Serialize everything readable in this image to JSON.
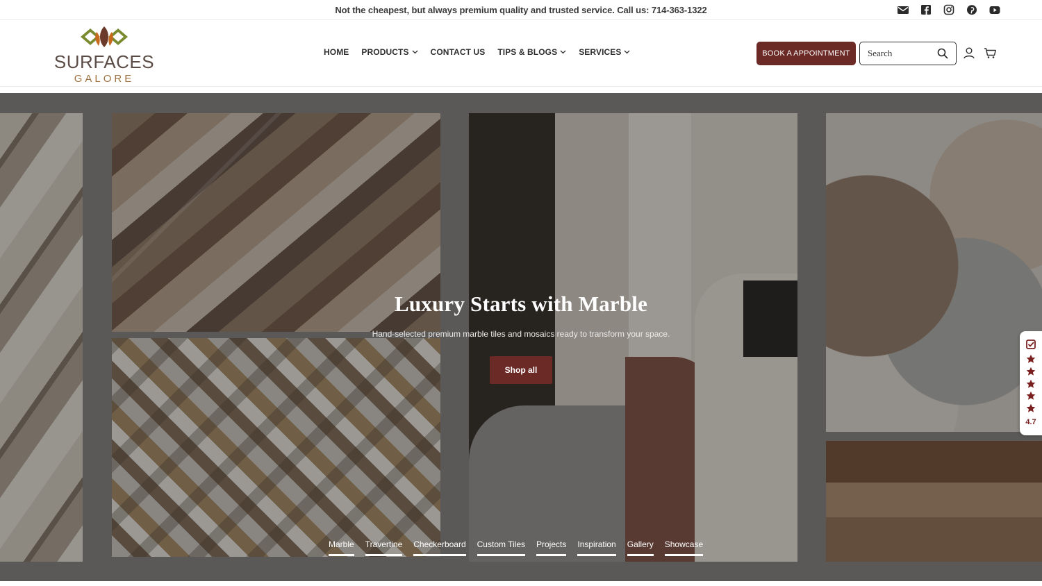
{
  "announcement": {
    "text": "Not the cheapest, but always premium quality and trusted service. Call us: 714-363-1322"
  },
  "social": [
    "email-icon",
    "facebook-icon",
    "instagram-icon",
    "pinterest-icon",
    "youtube-icon"
  ],
  "logo": {
    "word": "SURFACES",
    "sub": "GALORE"
  },
  "nav": {
    "items": [
      {
        "label": "HOME",
        "dropdown": false
      },
      {
        "label": "PRODUCTS",
        "dropdown": true
      },
      {
        "label": "CONTACT US",
        "dropdown": false
      },
      {
        "label": "TIPS & BLOGS",
        "dropdown": true
      },
      {
        "label": "SERVICES",
        "dropdown": true
      }
    ]
  },
  "header": {
    "book_label": "BOOK A APPOINTMENT",
    "search_placeholder": "Search"
  },
  "hero": {
    "title": "Luxury Starts with Marble",
    "subtitle": "Hand-selected premium marble tiles and mosaics ready to transform your space.",
    "cta": "Shop all",
    "tabs": [
      "Marble",
      "Travertine",
      "Checkerboard",
      "Custom Tiles",
      "Projects",
      "Inspiration",
      "Gallery",
      "Showcase"
    ]
  },
  "rating": {
    "value": "4.7",
    "stars": 5
  },
  "colors": {
    "brand": "#6b2a25",
    "logo_green": "#7a8a2e",
    "logo_orange": "#c86a1e",
    "logo_brown": "#6b3a2a"
  }
}
